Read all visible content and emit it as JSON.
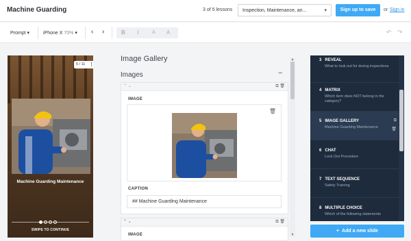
{
  "header": {
    "title": "Machine Guarding",
    "lessons_count": "3 of 5 lessons",
    "lesson_select": "Inspection, Maintenance, an...",
    "signup_label": "Sign up to save",
    "or_text": "or",
    "signin_label": "Sign in"
  },
  "toolbar": {
    "prompt_label": "Prompt",
    "device_label": "iPhone X",
    "zoom": "70%",
    "bold": "B",
    "italic": "I",
    "font_a_small": "A",
    "font_a_large": "A"
  },
  "preview": {
    "counter": "5 / 11",
    "caption": "Machine Guarding Maintenance",
    "swipe_label": "SWIPE TO CONTINUE"
  },
  "editor": {
    "section_title": "Image Gallery",
    "subsection_title": "Images",
    "image_label": "IMAGE",
    "caption_label": "CAPTION",
    "caption_value": "## Machine Guarding Maintenance",
    "image_label_2": "IMAGE"
  },
  "slides": [
    {
      "number": "3",
      "title": "REVEAL",
      "desc": "What to look out for during inspections"
    },
    {
      "number": "4",
      "title": "MATRIX",
      "desc": "Which item does NOT belong in the category?"
    },
    {
      "number": "5",
      "title": "IMAGE GALLERY",
      "desc": "Machine Guarding Maintenance"
    },
    {
      "number": "6",
      "title": "CHAT",
      "desc": "Lock Out Procedure"
    },
    {
      "number": "7",
      "title": "TEXT SEQUENCE",
      "desc": "Safety Training"
    },
    {
      "number": "8",
      "title": "MULTIPLE CHOICE",
      "desc": "Which of the following statements"
    }
  ],
  "add_slide_label": "Add a new slide",
  "colors": {
    "accent": "#3fa9f5",
    "sidebar_bg": "#1e2b3c",
    "link": "#2d8ee6"
  }
}
